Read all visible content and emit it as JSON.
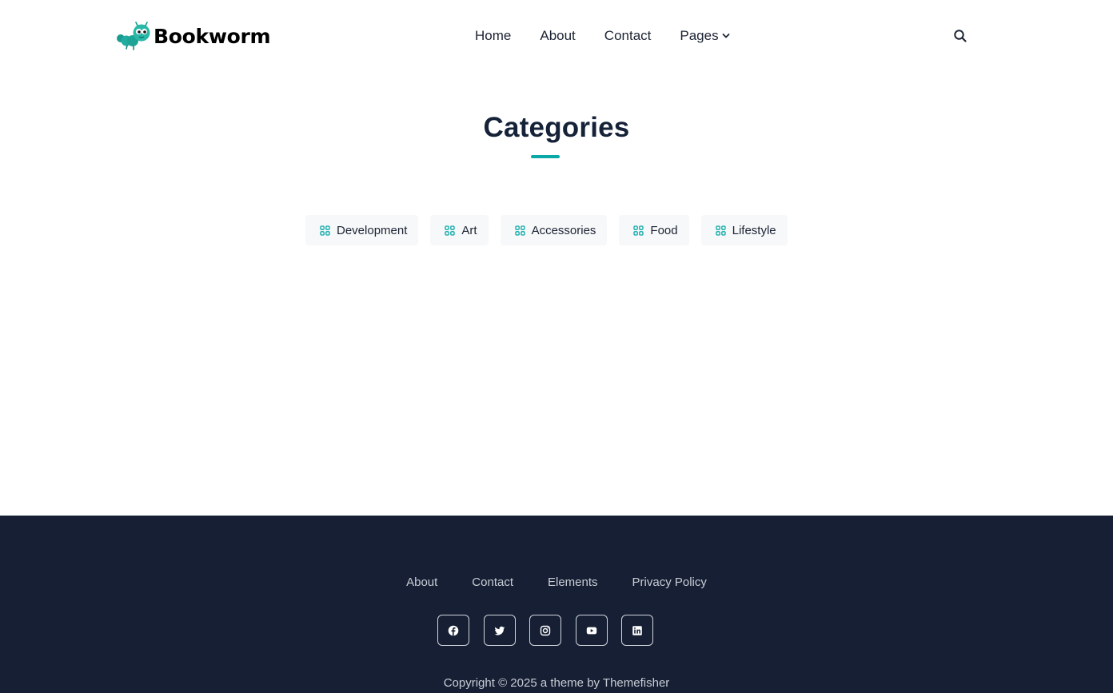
{
  "brand": {
    "name": "Bookworm",
    "accent_color": "#0aa8a7",
    "logo_icon": "worm-logo-icon"
  },
  "nav": {
    "items": [
      {
        "label": "Home"
      },
      {
        "label": "About"
      },
      {
        "label": "Contact"
      },
      {
        "label": "Pages",
        "icon": "chevron-down-icon"
      }
    ],
    "search_icon": "search-icon"
  },
  "page": {
    "title": "Categories"
  },
  "categories": [
    {
      "label": "Development",
      "icon": "grid-icon"
    },
    {
      "label": "Art",
      "icon": "grid-icon"
    },
    {
      "label": "Accessories",
      "icon": "grid-icon"
    },
    {
      "label": "Food",
      "icon": "grid-icon"
    },
    {
      "label": "Lifestyle",
      "icon": "grid-icon"
    }
  ],
  "footer": {
    "background_color": "#161f33",
    "links": [
      {
        "label": "About"
      },
      {
        "label": "Contact"
      },
      {
        "label": "Elements"
      },
      {
        "label": "Privacy Policy"
      }
    ],
    "socials": [
      "facebook-icon",
      "twitter-icon",
      "instagram-icon",
      "youtube-icon",
      "linkedin-icon"
    ],
    "copyright": "Copyright © 2025 a theme by Themefisher"
  }
}
